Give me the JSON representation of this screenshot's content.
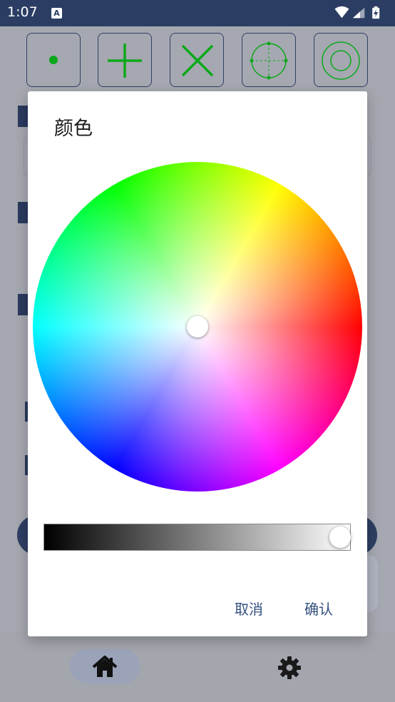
{
  "status_bar": {
    "time": "1:07",
    "notification_icon": "A",
    "icons": [
      "wifi-icon",
      "cellular-signal-icon",
      "battery-charging-icon"
    ]
  },
  "toolbar": {
    "buttons": [
      {
        "name": "dot-crosshair-button",
        "icon": "dot-icon"
      },
      {
        "name": "plus-crosshair-button",
        "icon": "plus-icon"
      },
      {
        "name": "x-crosshair-button",
        "icon": "x-icon"
      },
      {
        "name": "circle-crosshair-button",
        "icon": "circle-crosshair-icon"
      },
      {
        "name": "double-circle-crosshair-button",
        "icon": "double-circle-icon"
      }
    ],
    "icon_color": "#0aa81a"
  },
  "dialog": {
    "title": "颜色",
    "brightness_value": 1.0,
    "cancel_label": "取消",
    "confirm_label": "确认"
  },
  "bottom_nav": {
    "items": [
      {
        "name": "home",
        "icon": "home-icon",
        "active": true
      },
      {
        "name": "settings",
        "icon": "gear-icon",
        "active": false
      }
    ]
  },
  "colors": {
    "status_bar": "#2b3d63",
    "accent": "#33507e",
    "scrim": "#a6a8b1"
  }
}
